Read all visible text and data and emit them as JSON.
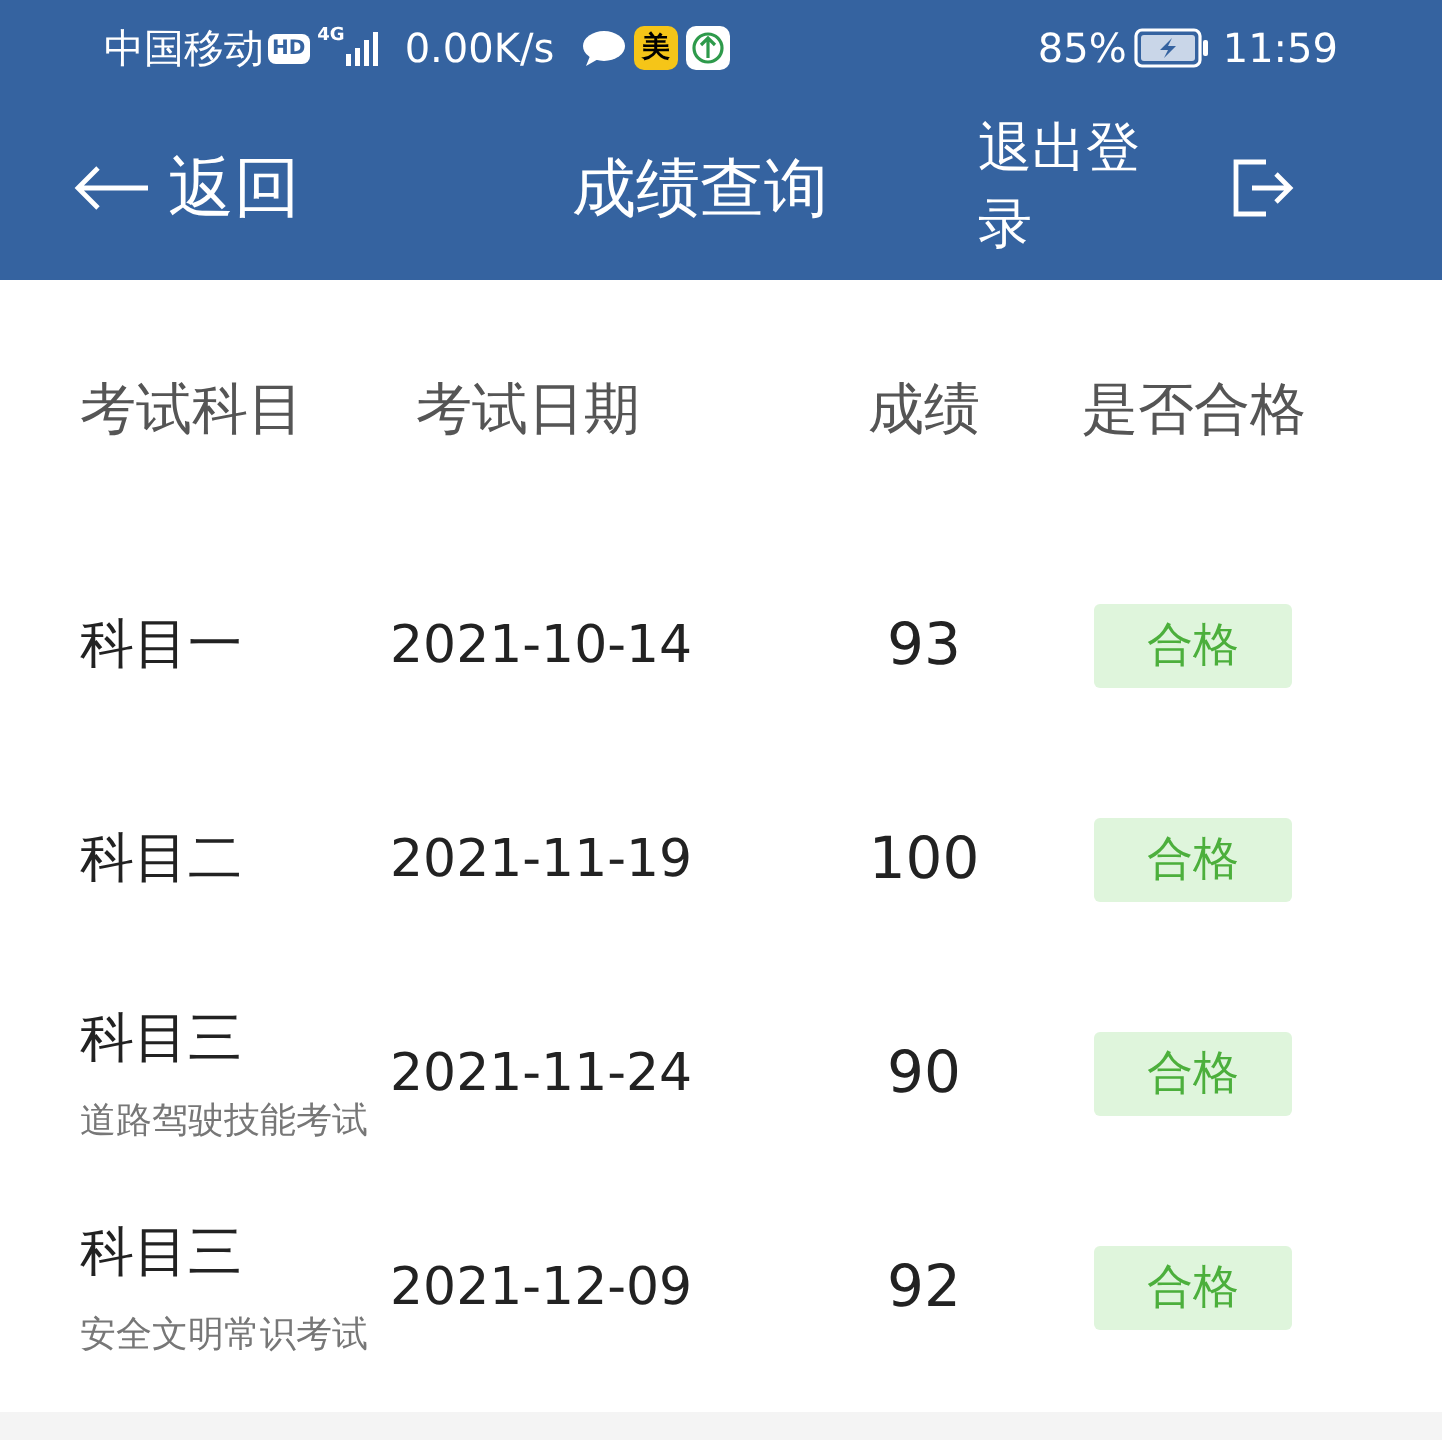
{
  "status_bar": {
    "carrier": "中国移动",
    "hd": "HD",
    "network": "4G",
    "speed": "0.00K/s",
    "app_badge": "美",
    "battery": "85%",
    "time": "11:59"
  },
  "app_bar": {
    "back": "返回",
    "title": "成绩查询",
    "logout": "退出登录"
  },
  "table": {
    "columns": [
      "考试科目",
      "考试日期",
      "成绩",
      "是否合格"
    ],
    "rows": [
      {
        "subject": "科目一",
        "date": "2021-10-14",
        "score": "93",
        "result": "合格",
        "passed": true
      },
      {
        "subject": "科目二",
        "date": "2021-11-19",
        "score": "100",
        "result": "合格",
        "passed": true
      },
      {
        "subject": "科目三",
        "note": "道路驾驶技能考试",
        "date": "2021-11-24",
        "score": "90",
        "result": "合格",
        "passed": true
      },
      {
        "subject": "科目三",
        "note": "安全文明常识考试",
        "date": "2021-12-09",
        "score": "92",
        "result": "合格",
        "passed": true
      }
    ]
  }
}
